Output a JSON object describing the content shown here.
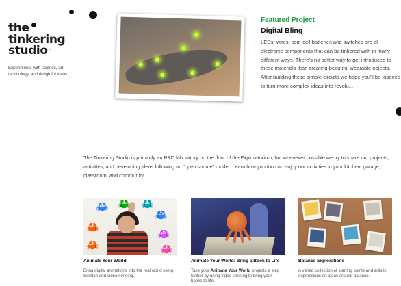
{
  "logo": {
    "lines": [
      "the",
      "tinkering",
      "studio"
    ],
    "tm": "™"
  },
  "tagline": "Experiments with science, art, technology, and delightful ideas.",
  "featured": {
    "kicker": "Featured Project",
    "title": "Digital Bling",
    "body": "LEDs, wires, coin-cell batteries and switches are all electronic components that can be tinkered with in many different ways. There's no better way to get introduced to these materials than creating beautiful wearable objects. After building these simple circuits we hope you'll be inspired to turn more complex ideas into revolu..."
  },
  "intro": "The Tinkering Studio is primarily an R&D laboratory on the floor of the Exploratorium, but whenever possible we try to share our projects, activities, and developing ideas following an “open source” model. Learn how you too can enjoy our activities in your kitchen, garage, classroom, and community.",
  "cards": [
    {
      "title": "Animate Your World",
      "desc": "Bring digital animations into the real world using Scratch and video sensing."
    },
    {
      "title": "Animate Your World: Bring a Book to Life",
      "desc_pre": "Take your ",
      "desc_bold": "Animate Your World",
      "desc_post": " projects a step further by using video sensing to bring your books to life."
    },
    {
      "title": "Balance Explorations",
      "desc": "A varied collection of starting points and artistic expressions on ideas around balance."
    }
  ],
  "colors": {
    "accent": "#1f9a3a",
    "text": "#444444",
    "heading": "#111111"
  },
  "icons": {
    "crab": "🦀"
  }
}
